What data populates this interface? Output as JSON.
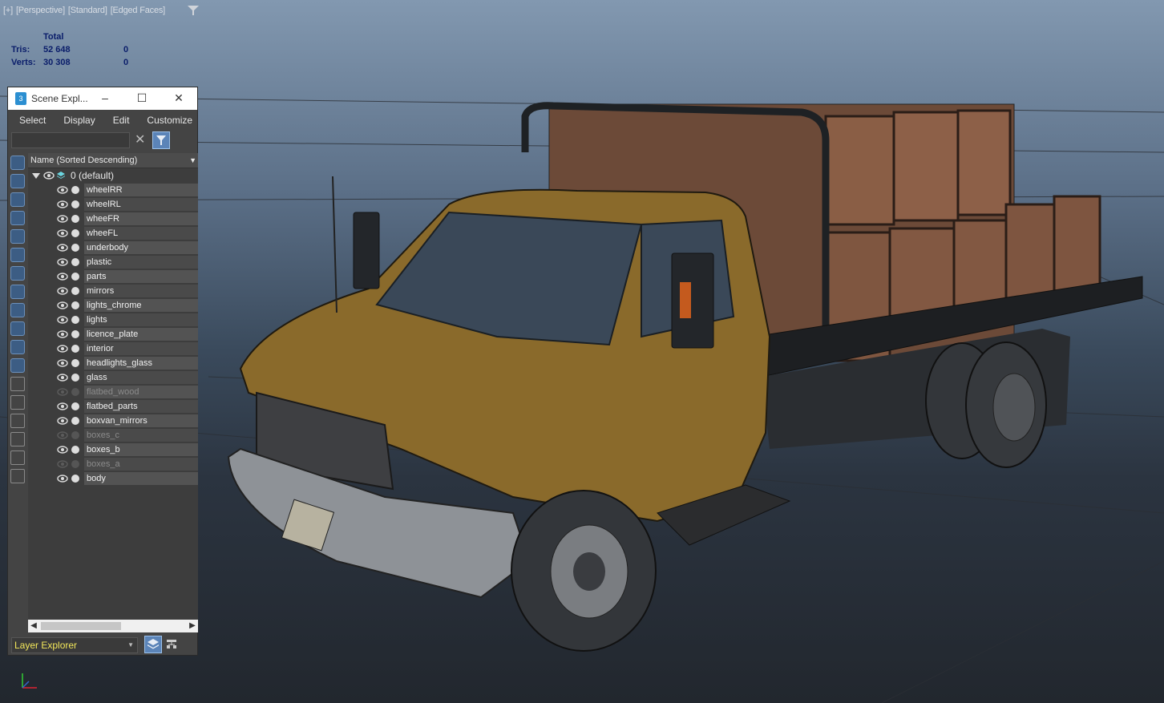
{
  "viewport": {
    "label_parts": [
      "[+]",
      "[Perspective]",
      "[Standard]",
      "[Edged Faces]"
    ],
    "filter_icon": "funnel-icon",
    "stats": {
      "header": "Total",
      "tris_label": "Tris:",
      "tris_total": "52 648",
      "tris_sel": "0",
      "verts_label": "Verts:",
      "verts_total": "30 308",
      "verts_sel": "0"
    },
    "scene_subject": "flatbed delivery truck with wooden crates, edged faces wireframe"
  },
  "scene_explorer": {
    "title": "Scene Expl...",
    "menu": [
      "Select",
      "Display",
      "Edit",
      "Customize"
    ],
    "search_value": "",
    "column_header": "Name (Sorted Descending)",
    "layer_name": "0 (default)",
    "items": [
      {
        "name": "wheelRR",
        "visible": true
      },
      {
        "name": "wheelRL",
        "visible": true
      },
      {
        "name": "wheeFR",
        "visible": true
      },
      {
        "name": "wheeFL",
        "visible": true
      },
      {
        "name": "underbody",
        "visible": true
      },
      {
        "name": "plastic",
        "visible": true
      },
      {
        "name": "parts",
        "visible": true
      },
      {
        "name": "mirrors",
        "visible": true
      },
      {
        "name": "lights_chrome",
        "visible": true
      },
      {
        "name": "lights",
        "visible": true
      },
      {
        "name": "licence_plate",
        "visible": true
      },
      {
        "name": "interior",
        "visible": true
      },
      {
        "name": "headlights_glass",
        "visible": true
      },
      {
        "name": "glass",
        "visible": true
      },
      {
        "name": "flatbed_wood",
        "visible": false
      },
      {
        "name": "flatbed_parts",
        "visible": true
      },
      {
        "name": "boxvan_mirrors",
        "visible": true
      },
      {
        "name": "boxes_c",
        "visible": false
      },
      {
        "name": "boxes_b",
        "visible": true
      },
      {
        "name": "boxes_a",
        "visible": false
      },
      {
        "name": "body",
        "visible": true
      }
    ],
    "explorer_mode": "Layer Explorer",
    "colors": {
      "accent": "#5b84b8",
      "mode_text": "#f2e65a"
    }
  }
}
